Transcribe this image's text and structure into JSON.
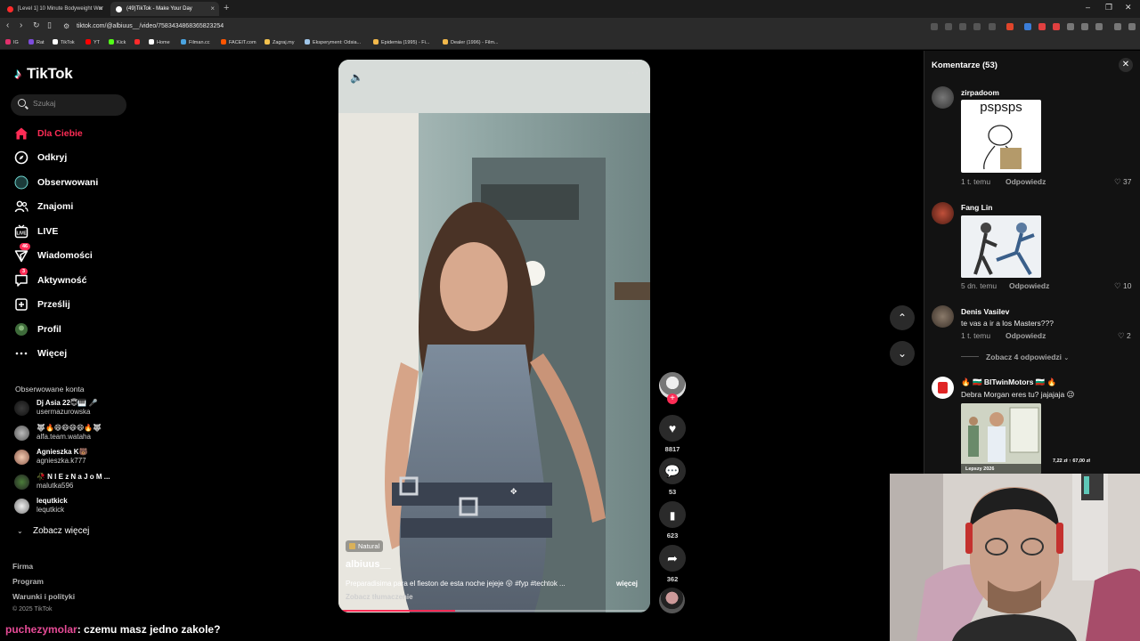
{
  "browser": {
    "tabs": [
      {
        "title": "[Level 1] 10 Minute Bodyweight Wor",
        "favicon_color": "#ff2b2b"
      },
      {
        "title": "(49)TikTok - Make Your Day",
        "favicon_color": "#ffffff"
      }
    ],
    "url": "tiktok.com/@albiuus__/video/7583434868365823254",
    "bookmarks": [
      {
        "label": "IG",
        "color": "#e1306c"
      },
      {
        "label": "Rat",
        "color": "#7d4cdb"
      },
      {
        "label": "YT",
        "color": "#ff0000"
      },
      {
        "label": "TikTok",
        "color": "#ffffff"
      },
      {
        "label": "Kick",
        "color": "#53fc18"
      },
      {
        "label": "",
        "color": "#ff2b2b"
      },
      {
        "label": "Home",
        "color": "#ffffff"
      },
      {
        "label": "Filman.cc",
        "color": "#4aa3df"
      },
      {
        "label": "FACEIT.com",
        "color": "#ff5500"
      },
      {
        "label": "Zagraj.my",
        "color": "#f2c14e"
      },
      {
        "label": "Eksperyment: Odsia...",
        "color": "#9fc5e8"
      },
      {
        "label": "Epidemia (1995) - Fi...",
        "color": "#f2b84b"
      },
      {
        "label": "Dealer (1996) - Film...",
        "color": "#f2b84b"
      }
    ]
  },
  "sidebar": {
    "logo": "TikTok",
    "search_placeholder": "Szukaj",
    "nav": [
      {
        "label": "Dla Ciebie",
        "icon": "home-icon",
        "active": true
      },
      {
        "label": "Odkryj",
        "icon": "compass-icon"
      },
      {
        "label": "Obserwowani",
        "icon": "following-avatar-icon"
      },
      {
        "label": "Znajomi",
        "icon": "friends-icon"
      },
      {
        "label": "LIVE",
        "icon": "live-icon"
      },
      {
        "label": "Wiadomości",
        "icon": "paper-plane-icon",
        "badge": "46"
      },
      {
        "label": "Aktywność",
        "icon": "activity-icon",
        "badge": "3"
      },
      {
        "label": "Prześlij",
        "icon": "upload-icon"
      },
      {
        "label": "Profil",
        "icon": "profile-avatar-icon"
      },
      {
        "label": "Więcej",
        "icon": "more-dots-icon"
      }
    ],
    "following_title": "Obserwowane konta",
    "following": [
      {
        "name": "Dj Asia 22😇🎹 🎤",
        "user": "usermazurowska"
      },
      {
        "name": "🐺🔥😄😄😄😄🔥🐺",
        "user": "alfa.team.wataha"
      },
      {
        "name": "Agnieszka K🐻",
        "user": "agnieszka.k777"
      },
      {
        "name": "🥀 N I E z N a J o M ...",
        "user": "malutka596"
      },
      {
        "name": "lequtkick",
        "user": "lequtkick"
      }
    ],
    "see_more": "Zobacz więcej",
    "footer": [
      "Firma",
      "Program",
      "Warunki i polityki"
    ],
    "copyright": "© 2025 TikTok"
  },
  "video": {
    "tag": "Natural",
    "username": "albiuus__",
    "description": "Preparadisima para el fieston de esta noche jejeje 😛 #fyp #techtok ...",
    "more": "więcej",
    "translate": "Zobacz tłumaczenie",
    "progress": 0.37
  },
  "actions": {
    "likes": "8817",
    "comments": "53",
    "saves": "623",
    "shares": "362"
  },
  "comments": {
    "title": "Komentarze (53)",
    "items": [
      {
        "user": "zirpadoom",
        "sticker_text": "pspsps",
        "time": "1 t. temu",
        "reply": "Odpowiedz",
        "likes": "37"
      },
      {
        "user": "Fang Lin",
        "sticker_text": "",
        "time": "5 dn. temu",
        "reply": "Odpowiedz",
        "likes": "10"
      },
      {
        "user": "Denis Vasilev",
        "text": "te vas a ir a los Masters???",
        "time": "1 t. temu",
        "reply": "Odpowiedz",
        "likes": "2"
      },
      {
        "user": "🔥 🇧🇬 BITwinMotors 🇧🇬 🔥",
        "text": "Debra Morgan eres tu? jajajaja 😉"
      }
    ],
    "view_replies": "Zobacz 4 odpowiedzi",
    "ad": {
      "label": "Lepszy 2026",
      "price": "7,22 zł ↑ 67,00 zł"
    }
  },
  "chat": {
    "name": "puchezymolar",
    "message": ": czemu masz jedno zakole?"
  }
}
